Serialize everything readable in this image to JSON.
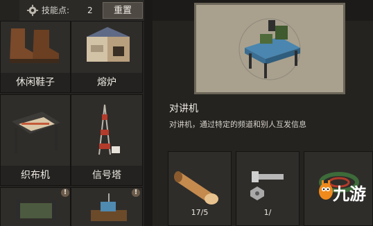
{
  "top_bar": {
    "skill_points_label": "技能点:",
    "skill_points_value": "2",
    "reset_label": "重置"
  },
  "crafting_grid": {
    "items": [
      {
        "label": "休闲鞋子",
        "icon": "boots-icon"
      },
      {
        "label": "熔炉",
        "icon": "furnace-icon"
      },
      {
        "label": "织布机",
        "icon": "loom-icon"
      },
      {
        "label": "信号塔",
        "icon": "signal-tower-icon"
      },
      {
        "label": "",
        "icon": "bed-icon"
      },
      {
        "label": "",
        "icon": "radio-table-icon"
      }
    ]
  },
  "detail": {
    "title": "对讲机",
    "description": "对讲机，通过特定的频道和别人互发信息",
    "materials": [
      {
        "icon": "wood-log-icon",
        "count": "17/5"
      },
      {
        "icon": "bolt-nut-icon",
        "count": "1/"
      },
      {
        "icon": "wire-coil-icon",
        "count": ""
      }
    ]
  },
  "watermark": {
    "text": "九游"
  }
}
